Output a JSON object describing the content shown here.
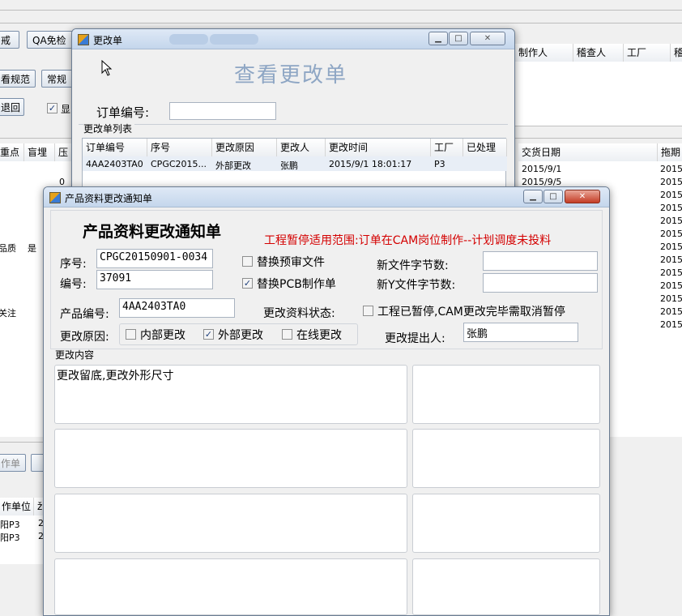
{
  "background": {
    "buttons": [
      "戒",
      "QA免检",
      "看规范",
      "常规",
      "退回",
      "作单"
    ],
    "checkbox_label": "显",
    "grid_headers": [
      "制作人",
      "稽查人",
      "工厂",
      "稽"
    ],
    "left_headers": [
      "重点",
      "盲埋",
      "压"
    ],
    "left_values": [
      "0",
      "品质",
      "是",
      "关注"
    ],
    "date_header": "交货日期",
    "delay_header": "拖期",
    "dates": [
      "2015/9/1",
      "2015/9/5"
    ],
    "delay_values": [
      "2015/",
      "2015/",
      "2015/",
      "2015/",
      "2015/",
      "2015/",
      "2015/",
      "2015/",
      "2015/",
      "2015/",
      "2015/",
      "2015/",
      "2015/"
    ],
    "lower_header": "作单位",
    "lower_rows": [
      "阳P3",
      "阳P3"
    ],
    "lower_col2": [
      "2",
      "2"
    ],
    "lower_col2_head": "ž"
  },
  "change_list_window": {
    "title": "更改单",
    "heading": "查看更改单",
    "order_label": "订单编号:",
    "order_value": "",
    "group_label": "更改单列表",
    "columns": [
      "订单编号",
      "序号",
      "更改原因",
      "更改人",
      "更改时间",
      "工厂",
      "已处理"
    ],
    "rows": [
      [
        "4AA2403TA0",
        "CPGC2015...",
        "外部更改",
        "张鹏",
        "2015/9/1 18:01:17",
        "P3",
        ""
      ]
    ],
    "window_controls": [
      "▁",
      "□",
      "✕"
    ]
  },
  "notice_window": {
    "title": "产品资料更改通知单",
    "heading": "产品资料更改通知单",
    "notice": "工程暂停适用范围:订单在CAM岗位制作--计划调度未投料",
    "serial_label": "序号:",
    "serial_value": "CPGC20150901-0034",
    "number_label": "编号:",
    "number_value": "37091",
    "replace_pre_review": "替换预审文件",
    "replace_pre_review_checked": false,
    "replace_pcb": "替换PCB制作单",
    "replace_pcb_checked": true,
    "new_file_bytes_label": "新文件字节数:",
    "new_file_bytes_value": "",
    "new_y_bytes_label": "新Y文件字节数:",
    "new_y_bytes_value": "",
    "product_label": "产品编号:",
    "product_value": "4AA2403TA0",
    "status_label": "更改资料状态:",
    "paused_label": "工程已暂停,CAM更改完毕需取消暂停",
    "paused_checked": false,
    "reason_label": "更改原因:",
    "reason_internal": "内部更改",
    "reason_internal_checked": false,
    "reason_external": "外部更改",
    "reason_external_checked": true,
    "reason_online": "在线更改",
    "reason_online_checked": false,
    "proposer_label": "更改提出人:",
    "proposer_value": "张鹏",
    "content_label": "更改内容",
    "content_value": "更改留底,更改外形尺寸",
    "window_controls": [
      "▁",
      "□",
      "✕"
    ]
  },
  "colors": {
    "notice_red": "#d40000",
    "heading_blue": "#8ea6c4",
    "titlebar": "#c8d8ec"
  }
}
